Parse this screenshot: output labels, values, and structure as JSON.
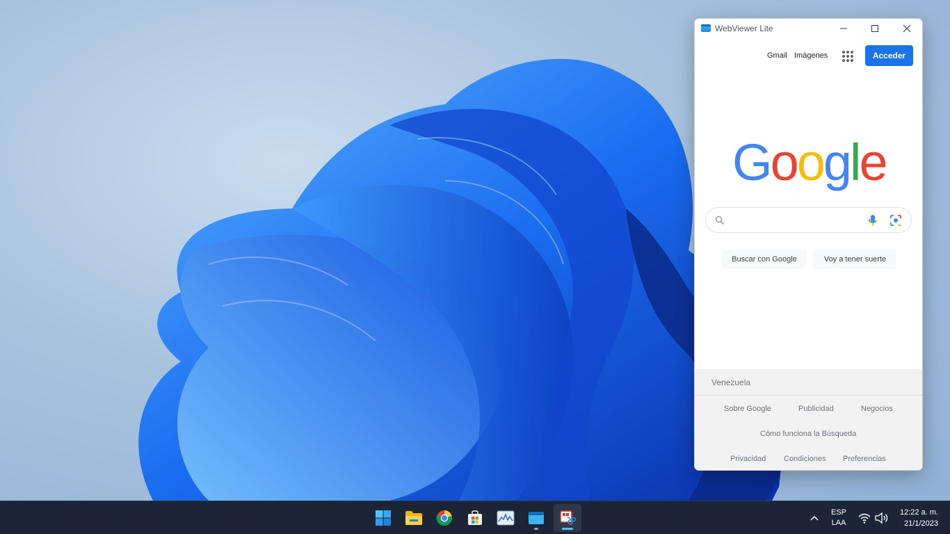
{
  "desktop": {
    "wallpaper": "windows-11-bloom"
  },
  "window": {
    "title": "WebViewer Lite",
    "controls": {
      "minimize": "—",
      "maximize": "☐",
      "close": "✕"
    },
    "google": {
      "nav": {
        "gmail": "Gmail",
        "images": "Imágenes",
        "sign_in": "Acceder"
      },
      "logo_text": "Google",
      "search_placeholder": "",
      "buttons": {
        "search": "Buscar con Google",
        "lucky": "Voy a tener suerte"
      },
      "footer": {
        "country": "Venezuela",
        "row1": [
          "Sobre Google",
          "Publicidad",
          "Negocios"
        ],
        "row2": [
          "Cómo funciona la Búsqueda"
        ],
        "row3": [
          "Privacidad",
          "Condiciones",
          "Preferencias"
        ]
      }
    }
  },
  "taskbar": {
    "apps": [
      "start-icon",
      "file-explorer-icon",
      "chrome-icon",
      "store-icon",
      "resource-monitor-icon",
      "webviewer-icon",
      "snipping-tool-icon"
    ],
    "tray": {
      "lang_line1": "ESP",
      "lang_line2": "LAA",
      "time": "12:22 a. m.",
      "date": "21/1/2023"
    }
  },
  "colors": {
    "accent": "#1a73e8",
    "taskbar": "#1c2536",
    "google_blue": "#4285F4",
    "google_red": "#EA4335",
    "google_yellow": "#FBBC05",
    "google_green": "#34A853"
  }
}
